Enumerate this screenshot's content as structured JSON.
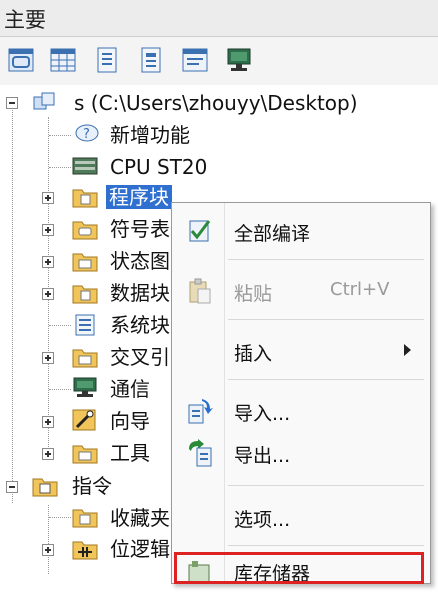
{
  "panel": {
    "title": "主要"
  },
  "toolbar": {
    "buttons": [
      {
        "icon": "view-program-icon"
      },
      {
        "icon": "view-table-icon"
      },
      {
        "icon": "view-symbols-icon"
      },
      {
        "icon": "view-status-icon"
      },
      {
        "icon": "view-data-icon"
      },
      {
        "icon": "view-communication-icon"
      }
    ]
  },
  "tree": {
    "root": {
      "label": "s (C:\\Users\\zhouyy\\Desktop)"
    },
    "items": [
      {
        "label": "新增功能",
        "icon": "help-icon"
      },
      {
        "label": "CPU ST20",
        "icon": "cpu-icon"
      },
      {
        "label": "程序块",
        "icon": "folder-program-icon",
        "selected": true
      },
      {
        "label": "符号表",
        "icon": "folder-symbol-icon"
      },
      {
        "label": "状态图",
        "icon": "folder-status-icon"
      },
      {
        "label": "数据块",
        "icon": "folder-data-icon"
      },
      {
        "label": "系统块",
        "icon": "system-block-icon"
      },
      {
        "label": "交叉引",
        "icon": "folder-crossref-icon"
      },
      {
        "label": "通信",
        "icon": "communication-icon"
      },
      {
        "label": "向导",
        "icon": "wizard-icon"
      },
      {
        "label": "工具",
        "icon": "folder-tools-icon"
      }
    ],
    "instructions": {
      "label": "指令",
      "icon": "instructions-icon"
    },
    "instruction_items": [
      {
        "label": "收藏夹",
        "icon": "favorites-icon"
      },
      {
        "label": "位逻辑",
        "icon": "bit-logic-icon"
      }
    ]
  },
  "context_menu": {
    "items": [
      {
        "label": "全部编译",
        "icon": "compile-all-icon",
        "enabled": true
      },
      {
        "label": "粘贴",
        "shortcut": "Ctrl+V",
        "icon": "paste-icon",
        "enabled": false
      },
      {
        "label": "插入",
        "submenu": true,
        "enabled": true
      },
      {
        "label": "导入...",
        "icon": "import-icon",
        "enabled": true
      },
      {
        "label": "导出...",
        "icon": "export-icon",
        "enabled": true
      },
      {
        "label": "选项...",
        "enabled": true
      },
      {
        "label": "库存储器",
        "icon": "library-memory-icon",
        "enabled": true,
        "highlighted": true
      }
    ]
  }
}
